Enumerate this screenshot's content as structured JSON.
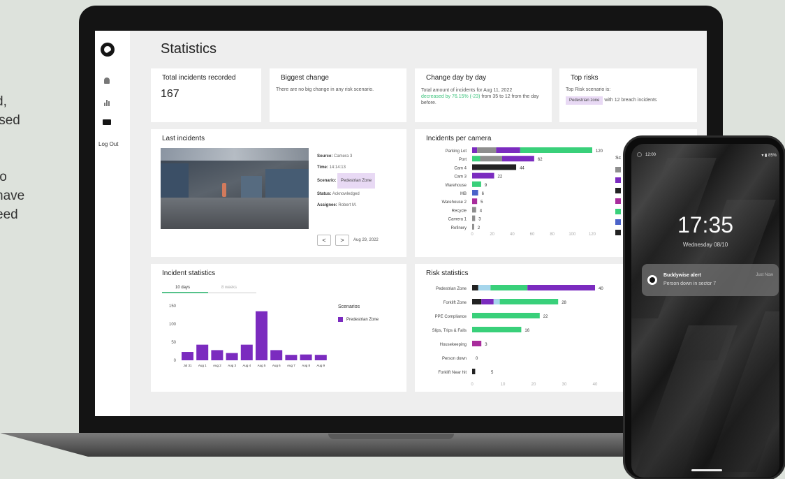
{
  "side_text": [
    "d,",
    "ised",
    ".",
    "",
    "to",
    "have",
    "eed"
  ],
  "sidebar": {
    "logout": "Log Out"
  },
  "page_title": "Statistics",
  "total_card": {
    "title": "Total incidents recorded",
    "value": "167"
  },
  "biggest_card": {
    "title": "Biggest change",
    "text": "There are no big change in any risk scenario."
  },
  "day_card": {
    "title": "Change day by day",
    "line1": "Total amount of incidents for Aug 11, 2022",
    "green": "decreased by 76.15% (-23)",
    "rest": "from 35 to 12 from the day before."
  },
  "risks_card": {
    "title": "Top risks",
    "line1": "Top Risk scenario is:",
    "pill": "Pedestrian zone",
    "rest": "with 12 breach incidents"
  },
  "last_incidents": {
    "title": "Last incidents",
    "rows": [
      {
        "k": "Source:",
        "v": "Camera 3"
      },
      {
        "k": "Time:",
        "v": "14:14:13"
      },
      {
        "k": "Scenario:",
        "v": "Pedestrian Zone"
      },
      {
        "k": "Status:",
        "v": "Acknowledged"
      },
      {
        "k": "Assignee:",
        "v": "Robert M."
      }
    ],
    "prev": "<",
    "next": ">",
    "date": "Aug 29, 2022"
  },
  "colors": {
    "purple": "#7b2bbf",
    "green": "#39d07a",
    "grey": "#8e8e8e",
    "black": "#222222",
    "lightblue": "#a6d6ec",
    "magenta": "#a82c9c",
    "blue": "#4b63c9"
  },
  "camera_card": {
    "title": "Incidents per camera",
    "legend_title": "Sc"
  },
  "incident_stats": {
    "title": "Incident statistics",
    "tab_active": "10 days",
    "tab_inactive": "8 weeks",
    "legend_title": "Scenarios",
    "legend_item": "Predestrian Zone"
  },
  "risk_card": {
    "title": "Risk statistics"
  },
  "chart_data": [
    {
      "type": "bar",
      "title": "Incidents per camera",
      "orientation": "horizontal",
      "categories": [
        "Parking Lot",
        "Port",
        "Cam 4",
        "Cam 3",
        "Warehouse",
        "MB",
        "Warehouse 2",
        "Recycle",
        "Camera 1",
        "Refinery"
      ],
      "totals": [
        120,
        62,
        44,
        22,
        9,
        6,
        5,
        4,
        3,
        2
      ],
      "segments": [
        [
          {
            "c": "purple",
            "v": 5
          },
          {
            "c": "grey",
            "v": 19
          },
          {
            "c": "purple",
            "v": 24
          },
          {
            "c": "green",
            "v": 72
          }
        ],
        [
          {
            "c": "green",
            "v": 8
          },
          {
            "c": "grey",
            "v": 22
          },
          {
            "c": "purple",
            "v": 32
          }
        ],
        [
          {
            "c": "black",
            "v": 44
          }
        ],
        [
          {
            "c": "purple",
            "v": 22
          }
        ],
        [
          {
            "c": "green",
            "v": 9
          }
        ],
        [
          {
            "c": "blue",
            "v": 6
          }
        ],
        [
          {
            "c": "magenta",
            "v": 5
          }
        ],
        [
          {
            "c": "grey",
            "v": 4
          }
        ],
        [
          {
            "c": "grey",
            "v": 3
          }
        ],
        [
          {
            "c": "grey",
            "v": 2
          }
        ]
      ],
      "xticks": [
        "0",
        "20",
        "40",
        "60",
        "80",
        "100",
        "120"
      ],
      "xlim": [
        0,
        120
      ]
    },
    {
      "type": "bar",
      "title": "Incident statistics",
      "categories": [
        "Jul 31",
        "Aug 1",
        "Aug 2",
        "Aug 3",
        "Aug 4",
        "Aug 5",
        "Aug 6",
        "Aug 7",
        "Aug 8",
        "Aug 9"
      ],
      "series": [
        {
          "name": "Predestrian Zone",
          "values": [
            23,
            43,
            28,
            20,
            43,
            135,
            28,
            15,
            16,
            15
          ]
        }
      ],
      "yticks": [
        "150",
        "100",
        "50",
        "0"
      ],
      "ylim": [
        0,
        150
      ]
    },
    {
      "type": "bar",
      "title": "Risk statistics",
      "orientation": "horizontal",
      "categories": [
        "Pedestrian Zone",
        "Forklift Zone",
        "PPE Compliance",
        "Slips, Trips & Falls",
        "Housekeeping",
        "Person down",
        "Forklift Near hit"
      ],
      "totals": [
        40,
        28,
        22,
        16,
        3,
        0,
        5
      ],
      "segments": [
        [
          {
            "c": "black",
            "v": 2
          },
          {
            "c": "lightblue",
            "v": 4
          },
          {
            "c": "green",
            "v": 12
          },
          {
            "c": "purple",
            "v": 22
          }
        ],
        [
          {
            "c": "black",
            "v": 3
          },
          {
            "c": "purple",
            "v": 4
          },
          {
            "c": "lightblue",
            "v": 2
          },
          {
            "c": "green",
            "v": 19
          }
        ],
        [
          {
            "c": "green",
            "v": 22
          }
        ],
        [
          {
            "c": "green",
            "v": 16
          }
        ],
        [
          {
            "c": "magenta",
            "v": 3
          }
        ],
        [],
        [
          {
            "c": "black",
            "v": 1
          }
        ]
      ],
      "xticks": [
        "0",
        "10",
        "20",
        "30",
        "40"
      ],
      "xlim": [
        0,
        40
      ]
    }
  ],
  "phone": {
    "time": "12:00",
    "battery": "▾ ▮ 85%",
    "clock": "17:35",
    "date": "Wednesday 08/10",
    "notif_title": "Buddywise alert",
    "notif_body": "Person down in sector 7",
    "notif_time": "Just Now"
  }
}
